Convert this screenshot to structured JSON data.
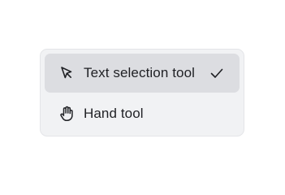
{
  "menu": {
    "items": [
      {
        "label": "Text selection tool",
        "icon": "cursor-arrow-icon",
        "selected": true
      },
      {
        "label": "Hand tool",
        "icon": "hand-icon",
        "selected": false
      }
    ],
    "selected_indicator_icon": "checkmark-icon"
  },
  "colors": {
    "menu_background": "#f1f2f4",
    "selected_background": "#dcdde1",
    "text": "#1f2024"
  }
}
